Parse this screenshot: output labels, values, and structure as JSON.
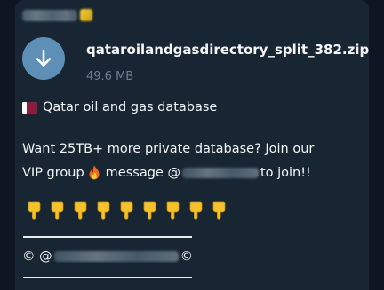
{
  "message": {
    "file": {
      "name": "qataroilandgasdirectory_split_382.zip",
      "size": "49.6 MB",
      "icon": "download-arrow-icon"
    },
    "title_line": "Qatar oil and gas database",
    "promo_line1": "Want 25TB+ more private database? Join our",
    "promo_line2_a": "VIP group",
    "promo_line2_b": "message @",
    "promo_line2_c": "to join!!",
    "copyright_prefix": "© @",
    "copyright_suffix": "©",
    "pointing_hands_count": 9
  },
  "colors": {
    "background": "#0e1621",
    "bubble": "#182533",
    "download_button": "#5e8fb7",
    "file_size_text": "#6d7f8f",
    "text": "#f5f5f5"
  }
}
